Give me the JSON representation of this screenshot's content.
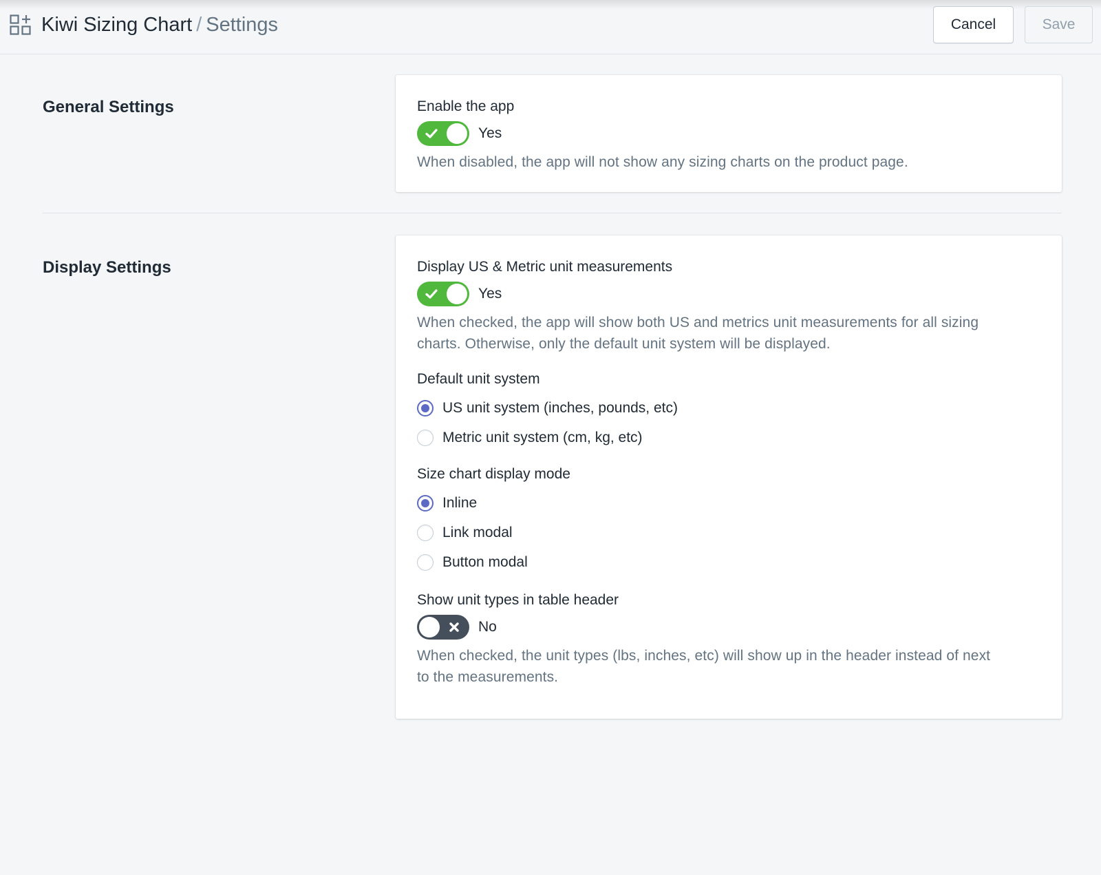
{
  "header": {
    "app_name": "Kiwi Sizing Chart",
    "separator": "/",
    "page_name": "Settings",
    "cancel_label": "Cancel",
    "save_label": "Save"
  },
  "general": {
    "title": "General Settings",
    "enable_app": {
      "label": "Enable the app",
      "state": "Yes",
      "enabled": true,
      "help": "When disabled, the app will not show any sizing charts on the product page."
    }
  },
  "display": {
    "title": "Display Settings",
    "us_metric": {
      "label": "Display US & Metric unit measurements",
      "state": "Yes",
      "enabled": true,
      "help_line1": "When checked, the app will show both US and metrics unit measurements for all sizing",
      "help_line2": "charts. Otherwise, only the default unit system will be displayed."
    },
    "default_unit": {
      "label": "Default unit system",
      "options": [
        {
          "label": "US unit system (inches, pounds, etc)",
          "selected": true
        },
        {
          "label": "Metric unit system (cm, kg, etc)",
          "selected": false
        }
      ]
    },
    "display_mode": {
      "label": "Size chart display mode",
      "options": [
        {
          "label": "Inline",
          "selected": true
        },
        {
          "label": "Link modal",
          "selected": false
        },
        {
          "label": "Button modal",
          "selected": false
        }
      ]
    },
    "unit_types_header": {
      "label": "Show unit types in table header",
      "state": "No",
      "enabled": false,
      "help_line1": "When checked, the unit types (lbs, inches, etc) will show up in the header instead of next",
      "help_line2": "to the measurements."
    }
  },
  "colors": {
    "toggle_on": "#50b83c",
    "toggle_off": "#454f5b",
    "radio_accent": "#5c6ac4",
    "help_text": "#637381"
  },
  "icons": {
    "app": "apps-add-icon",
    "toggle_on": "checkmark-icon",
    "toggle_off": "x-icon"
  }
}
